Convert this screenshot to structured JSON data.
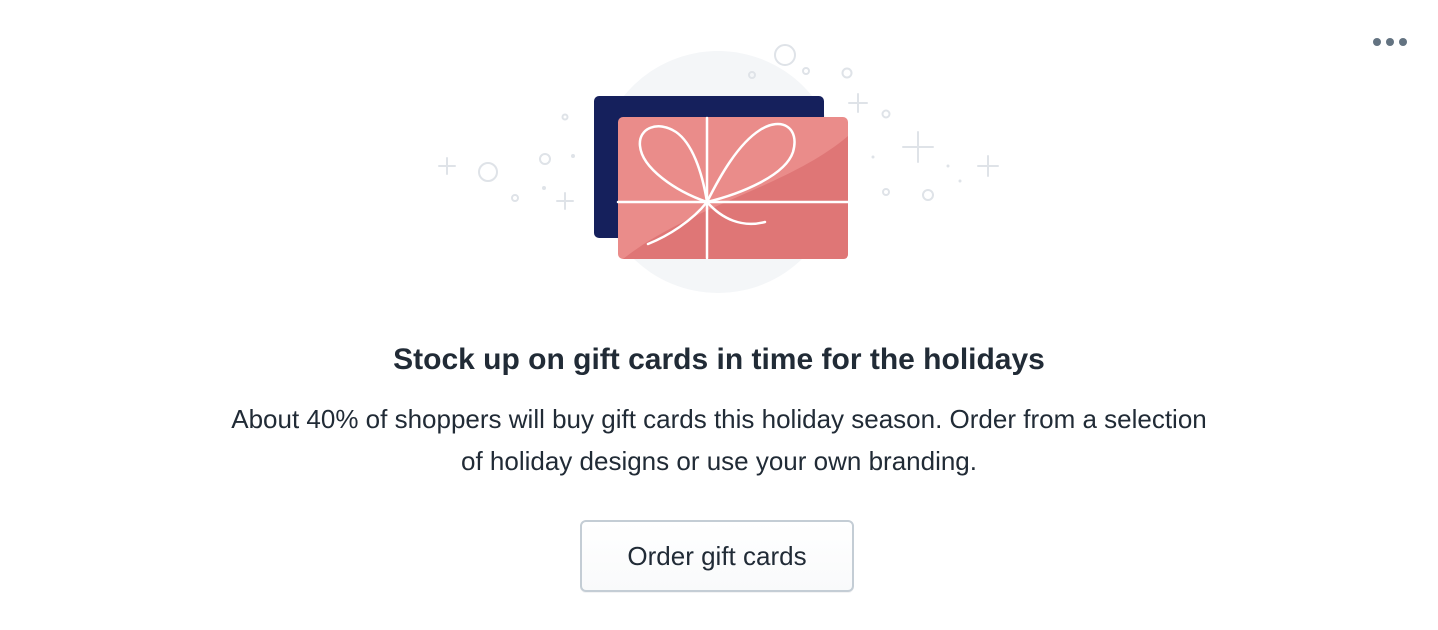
{
  "card": {
    "more_actions_icon": "horizontal-dots-icon",
    "illustration_icon": "gift-card-illustration",
    "heading": "Stock up on gift cards in time for the holidays",
    "body": "About 40% of shoppers will buy gift cards this holiday season. Order from a selection of holiday designs or use your own branding.",
    "cta_label": "Order gift cards"
  },
  "colors": {
    "text": "#212b36",
    "card_navy": "#15205c",
    "card_pink": "#ea8c8a",
    "card_pink_dark": "#df7676",
    "backdrop": "#f4f6f8",
    "sparkle": "#dfe3e8",
    "dots": "#637381",
    "button_border": "#c4cdd5"
  }
}
